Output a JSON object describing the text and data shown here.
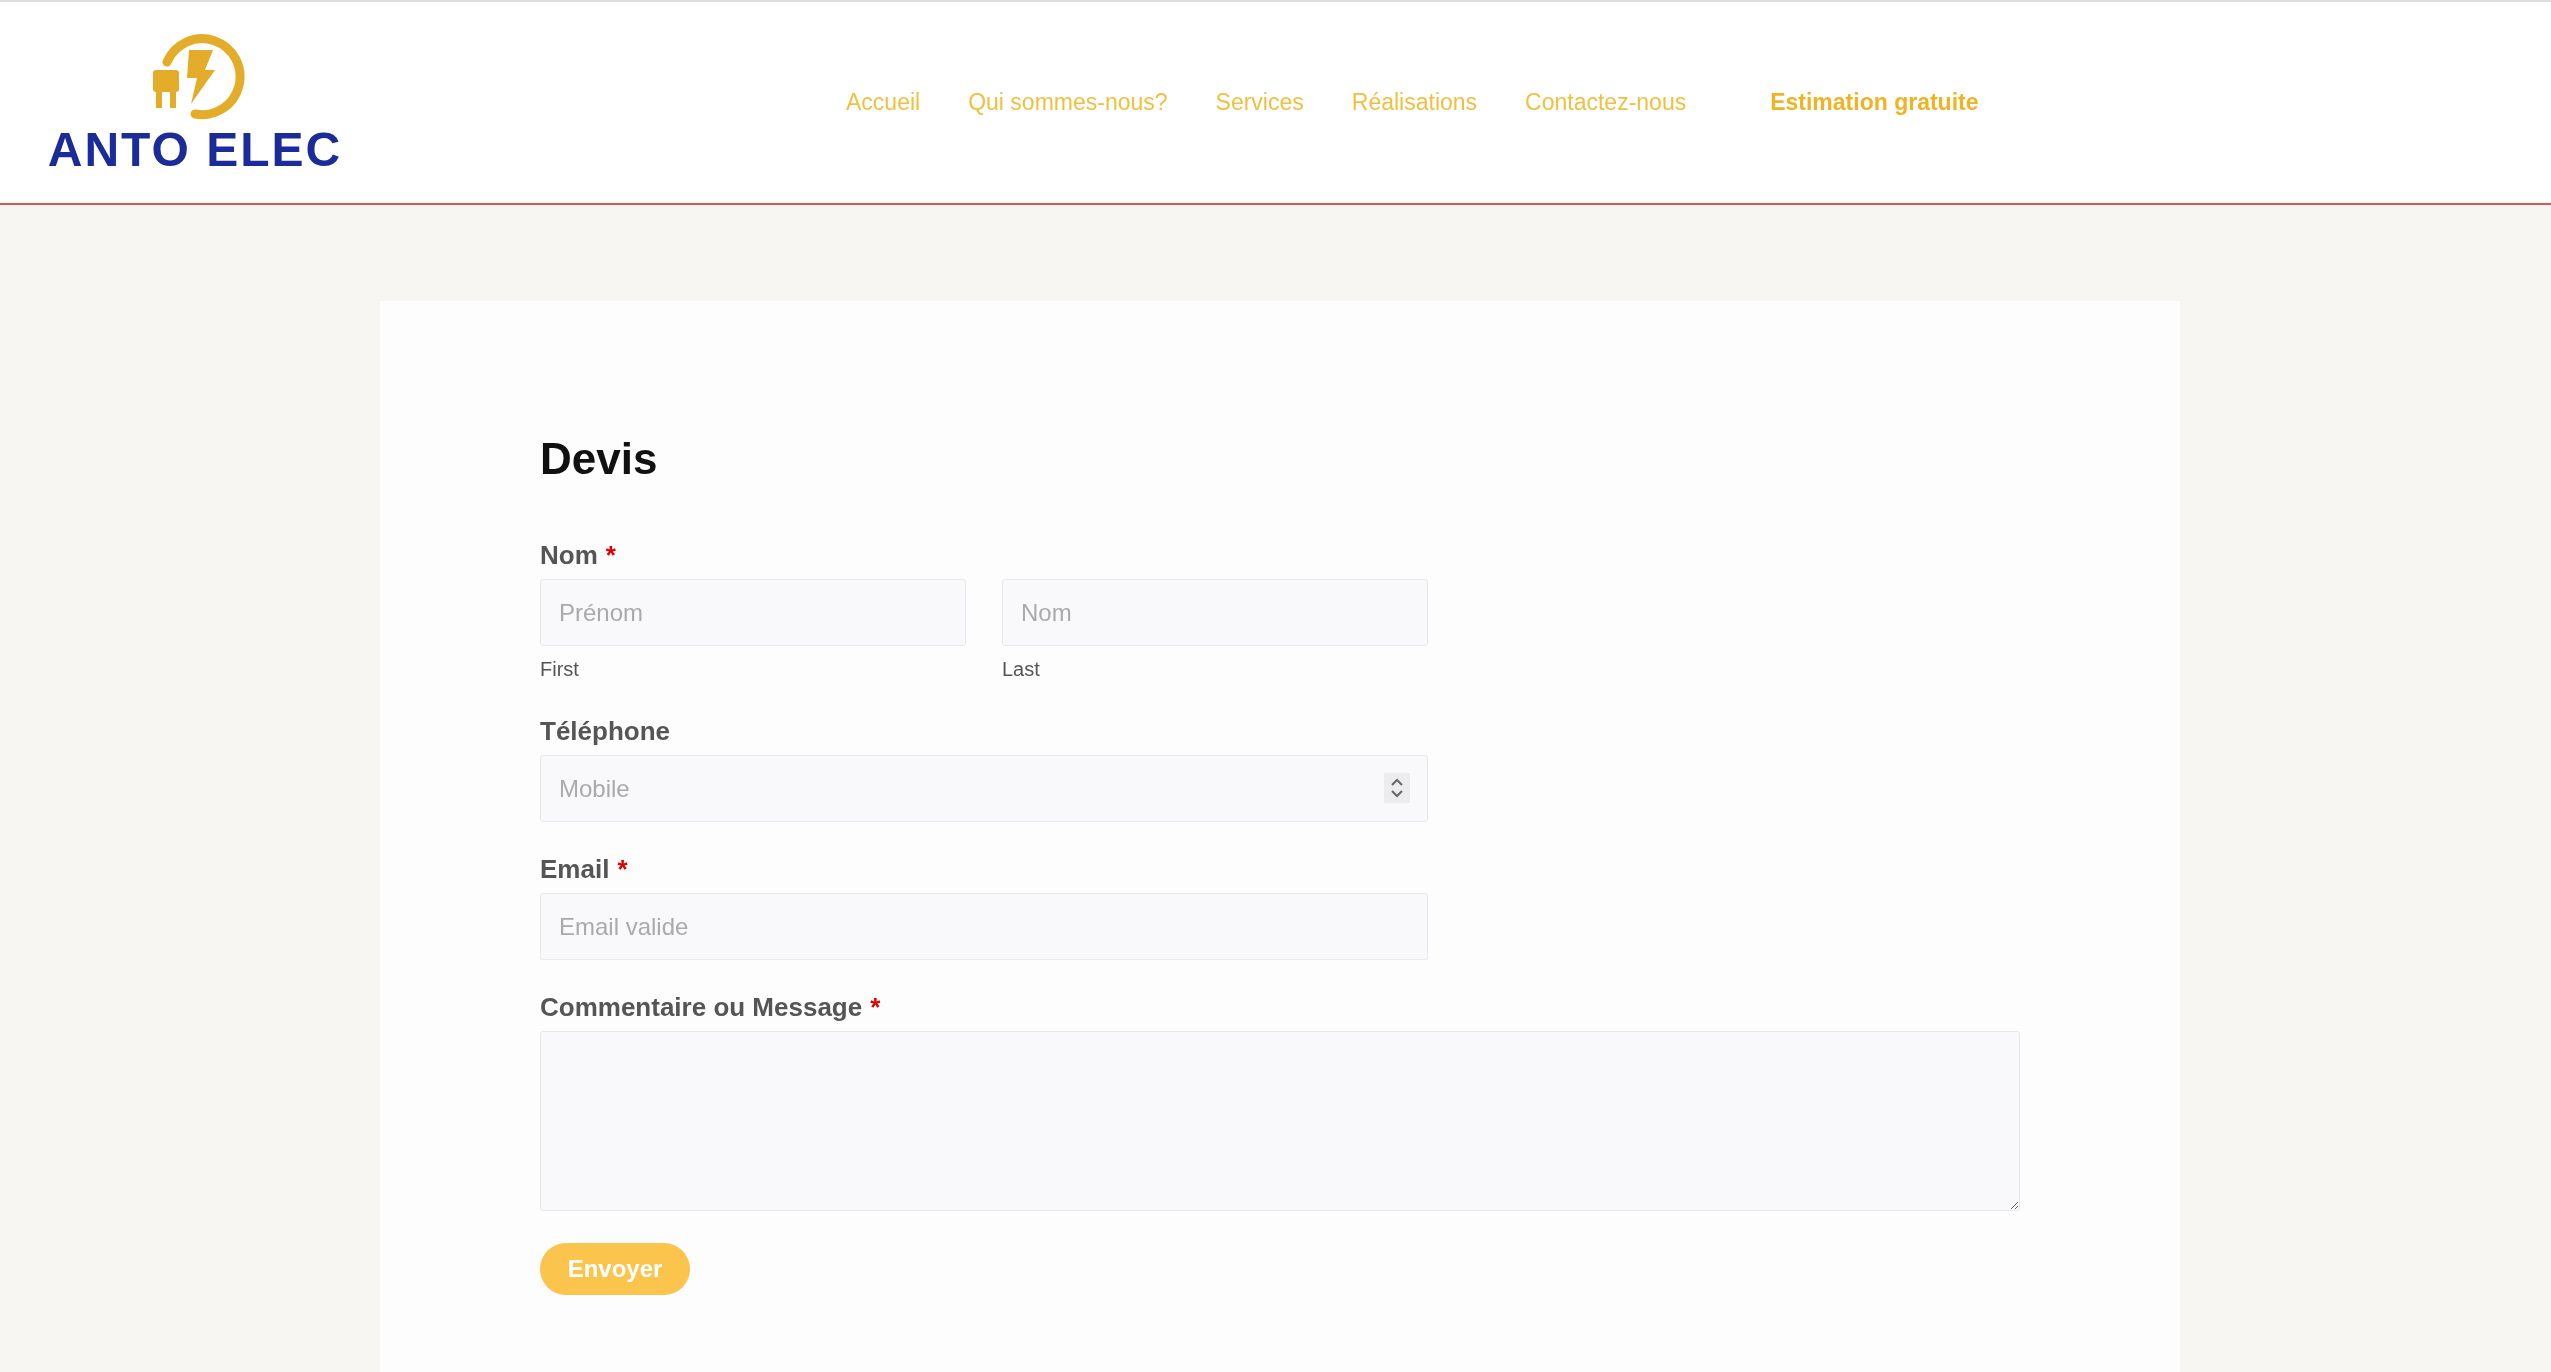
{
  "header": {
    "logo_text": "ANTO ELEC",
    "nav": [
      {
        "label": "Accueil",
        "kind": "link"
      },
      {
        "label": "Qui sommes-nous?",
        "kind": "link"
      },
      {
        "label": "Services",
        "kind": "link"
      },
      {
        "label": "Réalisations",
        "kind": "link"
      },
      {
        "label": "Contactez-nous",
        "kind": "link"
      },
      {
        "label": "Estimation gratuite",
        "kind": "cta"
      }
    ]
  },
  "form": {
    "title": "Devis",
    "fields": [
      {
        "kind": "name",
        "label": "Nom",
        "required_mark": "*",
        "parts": [
          {
            "placeholder": "Prénom",
            "sublabel": "First"
          },
          {
            "placeholder": "Nom",
            "sublabel": "Last"
          }
        ]
      },
      {
        "kind": "phone",
        "label": "Téléphone",
        "placeholder": "Mobile"
      },
      {
        "kind": "text",
        "label": "Email",
        "required_mark": "*",
        "placeholder": "Email valide"
      },
      {
        "kind": "textarea",
        "label": "Commentaire ou Message",
        "required_mark": "*"
      }
    ],
    "submit": "Envoyer"
  }
}
